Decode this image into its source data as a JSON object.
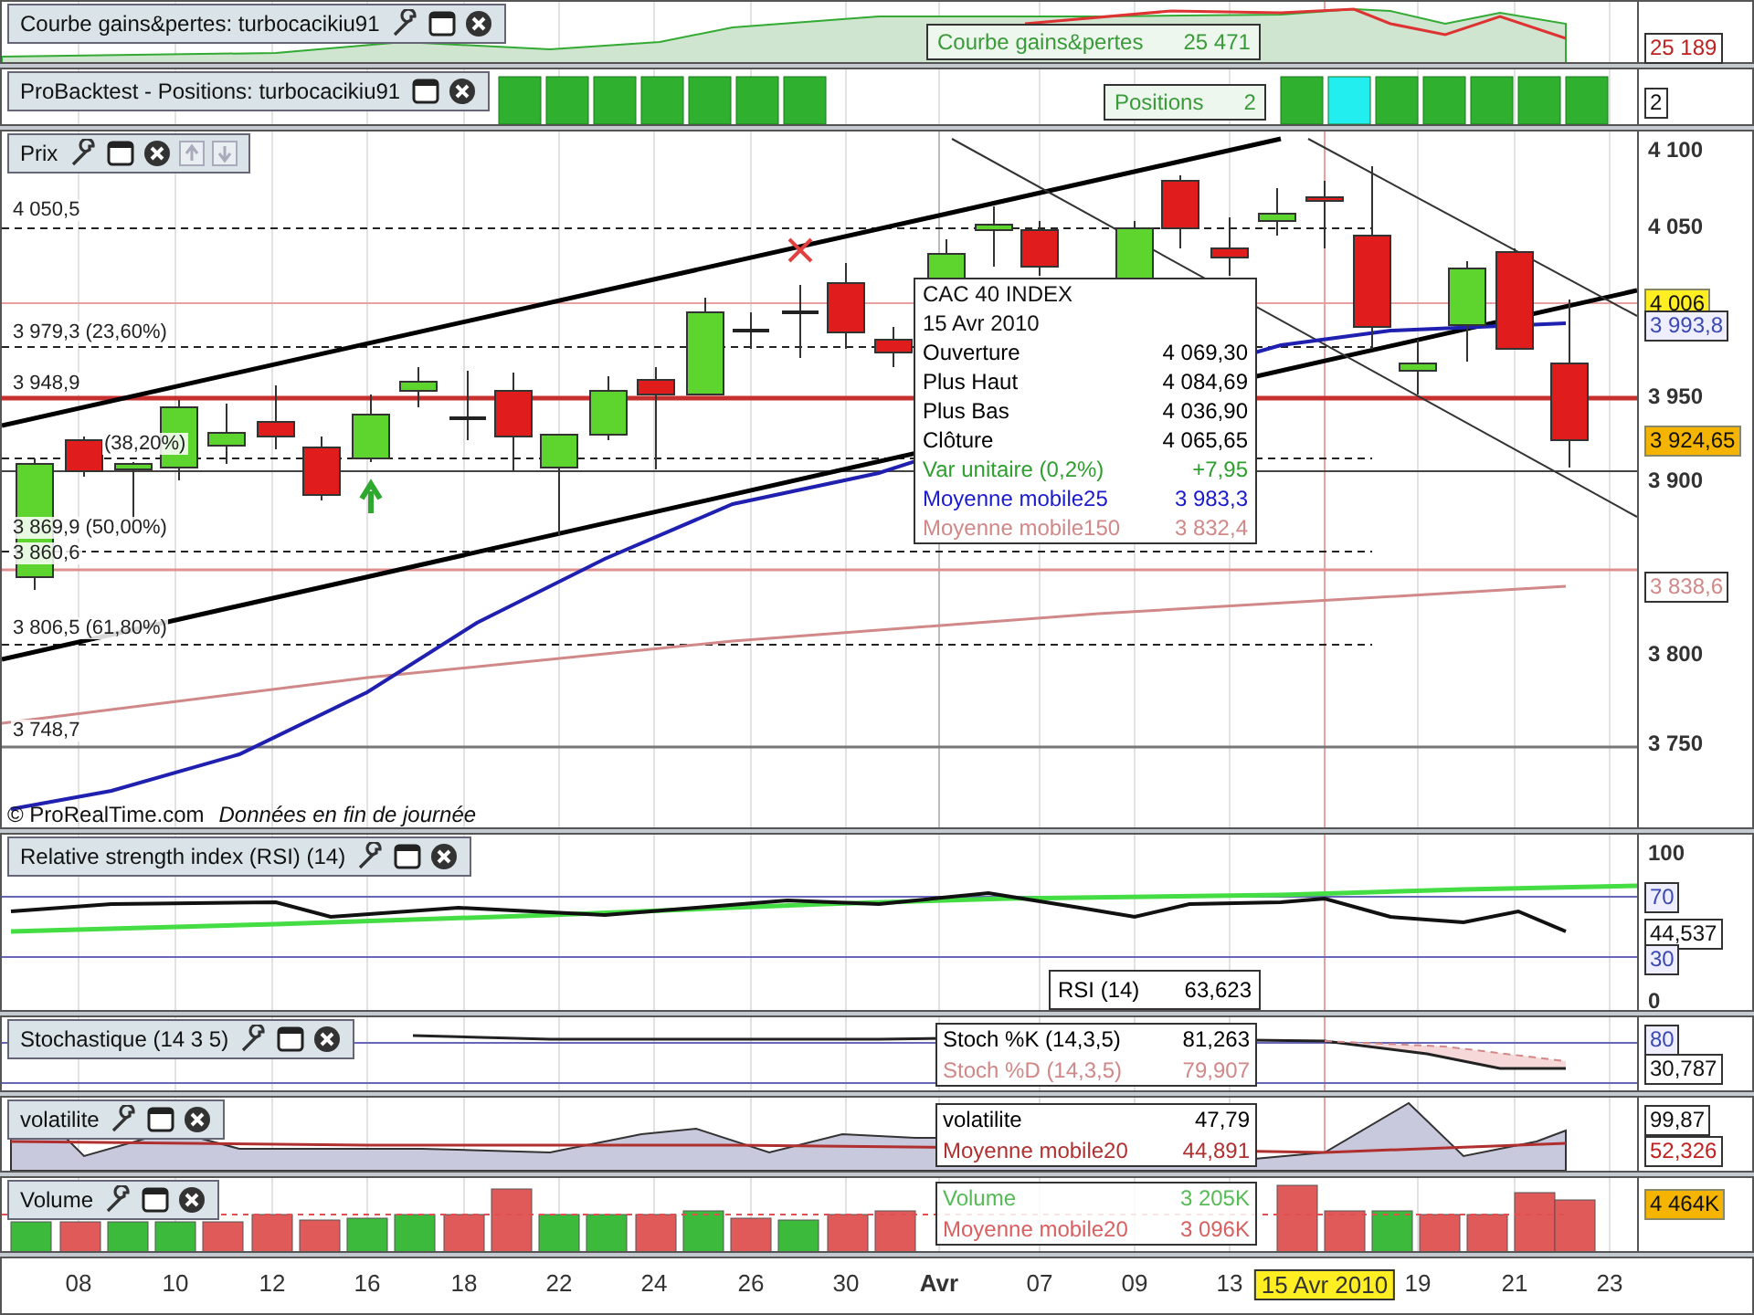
{
  "gains_panel": {
    "title": "Courbe gains&pertes: turbocacikiu91",
    "legend_label": "Courbe gains&pertes",
    "legend_value": "25 471",
    "axis": [
      {
        "text": "25 189",
        "kind": "box-red"
      }
    ]
  },
  "positions_panel": {
    "title": "ProBacktest - Positions: turbocacikiu91",
    "legend_label": "Positions",
    "legend_value": "2",
    "axis": [
      {
        "text": "2",
        "kind": "box"
      }
    ]
  },
  "price_panel": {
    "title": "Prix",
    "levels": [
      "4 050,5",
      "3 979,3 (23,60%)",
      "3 948,9",
      "(38,20%)",
      "3 869,9 (50,00%)",
      "3 860,6",
      "3 806,5 (61,80%)",
      "3 748,7"
    ],
    "copyright": "© ProRealTime.com",
    "note": "Données en fin de journée",
    "axis": [
      {
        "text": "4 100",
        "kind": "tick"
      },
      {
        "text": "4 050",
        "kind": "tick"
      },
      {
        "text": "4 006",
        "kind": "fill-yellow"
      },
      {
        "text": "3 993,8",
        "kind": "box-blue"
      },
      {
        "text": "3 950",
        "kind": "tick"
      },
      {
        "text": "3 924,65",
        "kind": "fill-orange"
      },
      {
        "text": "3 900",
        "kind": "tick"
      },
      {
        "text": "3 838,6",
        "kind": "box-pink"
      },
      {
        "text": "3 800",
        "kind": "tick"
      },
      {
        "text": "3 750",
        "kind": "tick"
      }
    ],
    "tooltip": {
      "title": "CAC 40 INDEX",
      "date": "15 Avr 2010",
      "rows": [
        {
          "label": "Ouverture",
          "value": "4 069,30",
          "color": "#000000"
        },
        {
          "label": "Plus Haut",
          "value": "4 084,69",
          "color": "#000000"
        },
        {
          "label": "Plus Bas",
          "value": "4 036,90",
          "color": "#000000"
        },
        {
          "label": "Clôture",
          "value": "4 065,65",
          "color": "#000000"
        },
        {
          "label": "Var unitaire (0,2%)",
          "value": "+7,95",
          "color": "#2e9e2e"
        },
        {
          "label": "Moyenne mobile25",
          "value": "3 983,3",
          "color": "#1a1acc"
        },
        {
          "label": "Moyenne mobile150",
          "value": "3 832,4",
          "color": "#d08888"
        }
      ]
    }
  },
  "indicators": [
    {
      "kind": "rsi",
      "title": "Relative strength index (RSI) (14)",
      "legend": [
        {
          "label": "RSI (14)",
          "value": "63,623",
          "color": "#000000"
        }
      ],
      "axis": [
        {
          "text": "100",
          "kind": "tick"
        },
        {
          "text": "70",
          "kind": "box-blue"
        },
        {
          "text": "44,537",
          "kind": "box"
        },
        {
          "text": "30",
          "kind": "box-blue"
        },
        {
          "text": "0",
          "kind": "tick"
        }
      ]
    },
    {
      "kind": "stoch",
      "title": "Stochastique (14 3 5)",
      "legend": [
        {
          "label": "Stoch %K (14,3,5)",
          "value": "81,263",
          "color": "#000000"
        },
        {
          "label": "Stoch %D (14,3,5)",
          "value": "79,907",
          "color": "#d08888"
        }
      ],
      "axis": [
        {
          "text": "80",
          "kind": "box-blue"
        },
        {
          "text": "30,787",
          "kind": "box"
        }
      ]
    },
    {
      "kind": "volatility",
      "title": "volatilite",
      "legend": [
        {
          "label": "volatilite",
          "value": "47,79",
          "color": "#000000"
        },
        {
          "label": "Moyenne mobile20",
          "value": "44,891",
          "color": "#b03030"
        }
      ],
      "axis": [
        {
          "text": "99,87",
          "kind": "box"
        },
        {
          "text": "52,326",
          "kind": "box-red"
        }
      ]
    },
    {
      "kind": "volume",
      "title": "Volume",
      "legend": [
        {
          "label": "Volume",
          "value": "3 205K",
          "color": "#55bb55"
        },
        {
          "label": "Moyenne mobile20",
          "value": "3 096K",
          "color": "#d86060"
        }
      ],
      "axis": [
        {
          "text": "4 464K",
          "kind": "fill-orange"
        }
      ]
    }
  ],
  "x_axis": [
    {
      "label": "08",
      "selected": false
    },
    {
      "label": "10",
      "selected": false
    },
    {
      "label": "12",
      "selected": false
    },
    {
      "label": "16",
      "selected": false
    },
    {
      "label": "18",
      "selected": false
    },
    {
      "label": "22",
      "selected": false
    },
    {
      "label": "24",
      "selected": false
    },
    {
      "label": "26",
      "selected": false
    },
    {
      "label": "30",
      "selected": false
    },
    {
      "label": "Avr",
      "selected": false
    },
    {
      "label": "07",
      "selected": false
    },
    {
      "label": "09",
      "selected": false
    },
    {
      "label": "13",
      "selected": false
    },
    {
      "label": "15 Avr 2010",
      "selected": true
    },
    {
      "label": "19",
      "selected": false
    },
    {
      "label": "21",
      "selected": false
    },
    {
      "label": "23",
      "selected": false
    }
  ]
}
